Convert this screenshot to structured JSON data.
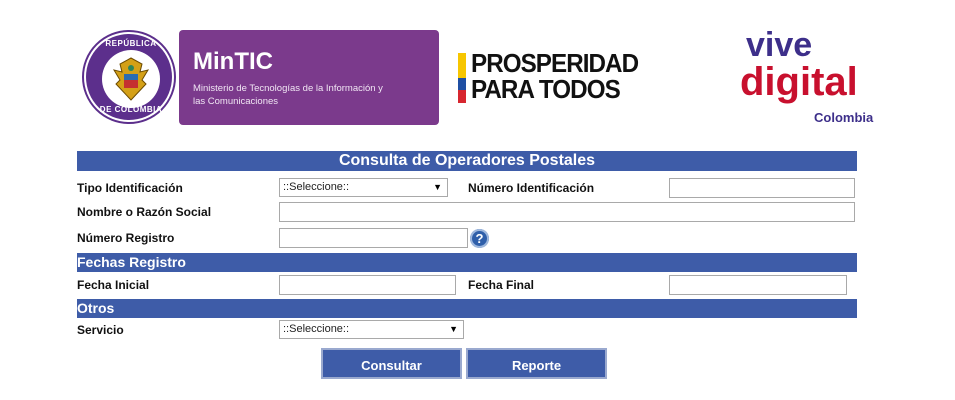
{
  "header": {
    "seal_top": "REPÚBLICA",
    "seal_bottom": "DE COLOMBIA",
    "mintic_title": "MinTIC",
    "mintic_subtitle": "Ministerio de Tecnologías de la Información y las Comunicaciones",
    "prosperidad_line1": "PROSPERIDAD",
    "prosperidad_line2": "PARA TODOS",
    "vive_line1": "vive",
    "vive_line2": "digital",
    "vive_line3": "Colombia"
  },
  "form": {
    "title": "Consulta de Operadores Postales",
    "tipo_identificacion_label": "Tipo Identificación",
    "tipo_identificacion_value": "::Seleccione::",
    "numero_identificacion_label": "Número Identificación",
    "numero_identificacion_value": "",
    "nombre_label": "Nombre o Razón Social",
    "nombre_value": "",
    "numero_registro_label": "Número Registro",
    "numero_registro_value": "",
    "help_glyph": "?",
    "fechas_section": "Fechas Registro",
    "fecha_inicial_label": "Fecha Inicial",
    "fecha_inicial_value": "",
    "fecha_final_label": "Fecha Final",
    "fecha_final_value": "",
    "otros_section": "Otros",
    "servicio_label": "Servicio",
    "servicio_value": "::Seleccione::",
    "consultar_label": "Consultar",
    "reporte_label": "Reporte"
  },
  "colors": {
    "bar": "#3e5ca8",
    "mintic": "#7b3a8c",
    "vive_red": "#c8102e",
    "vive_blue": "#3d2f8a"
  },
  "icons": {
    "help": "question-circle",
    "dropdown": "triangle-down"
  }
}
